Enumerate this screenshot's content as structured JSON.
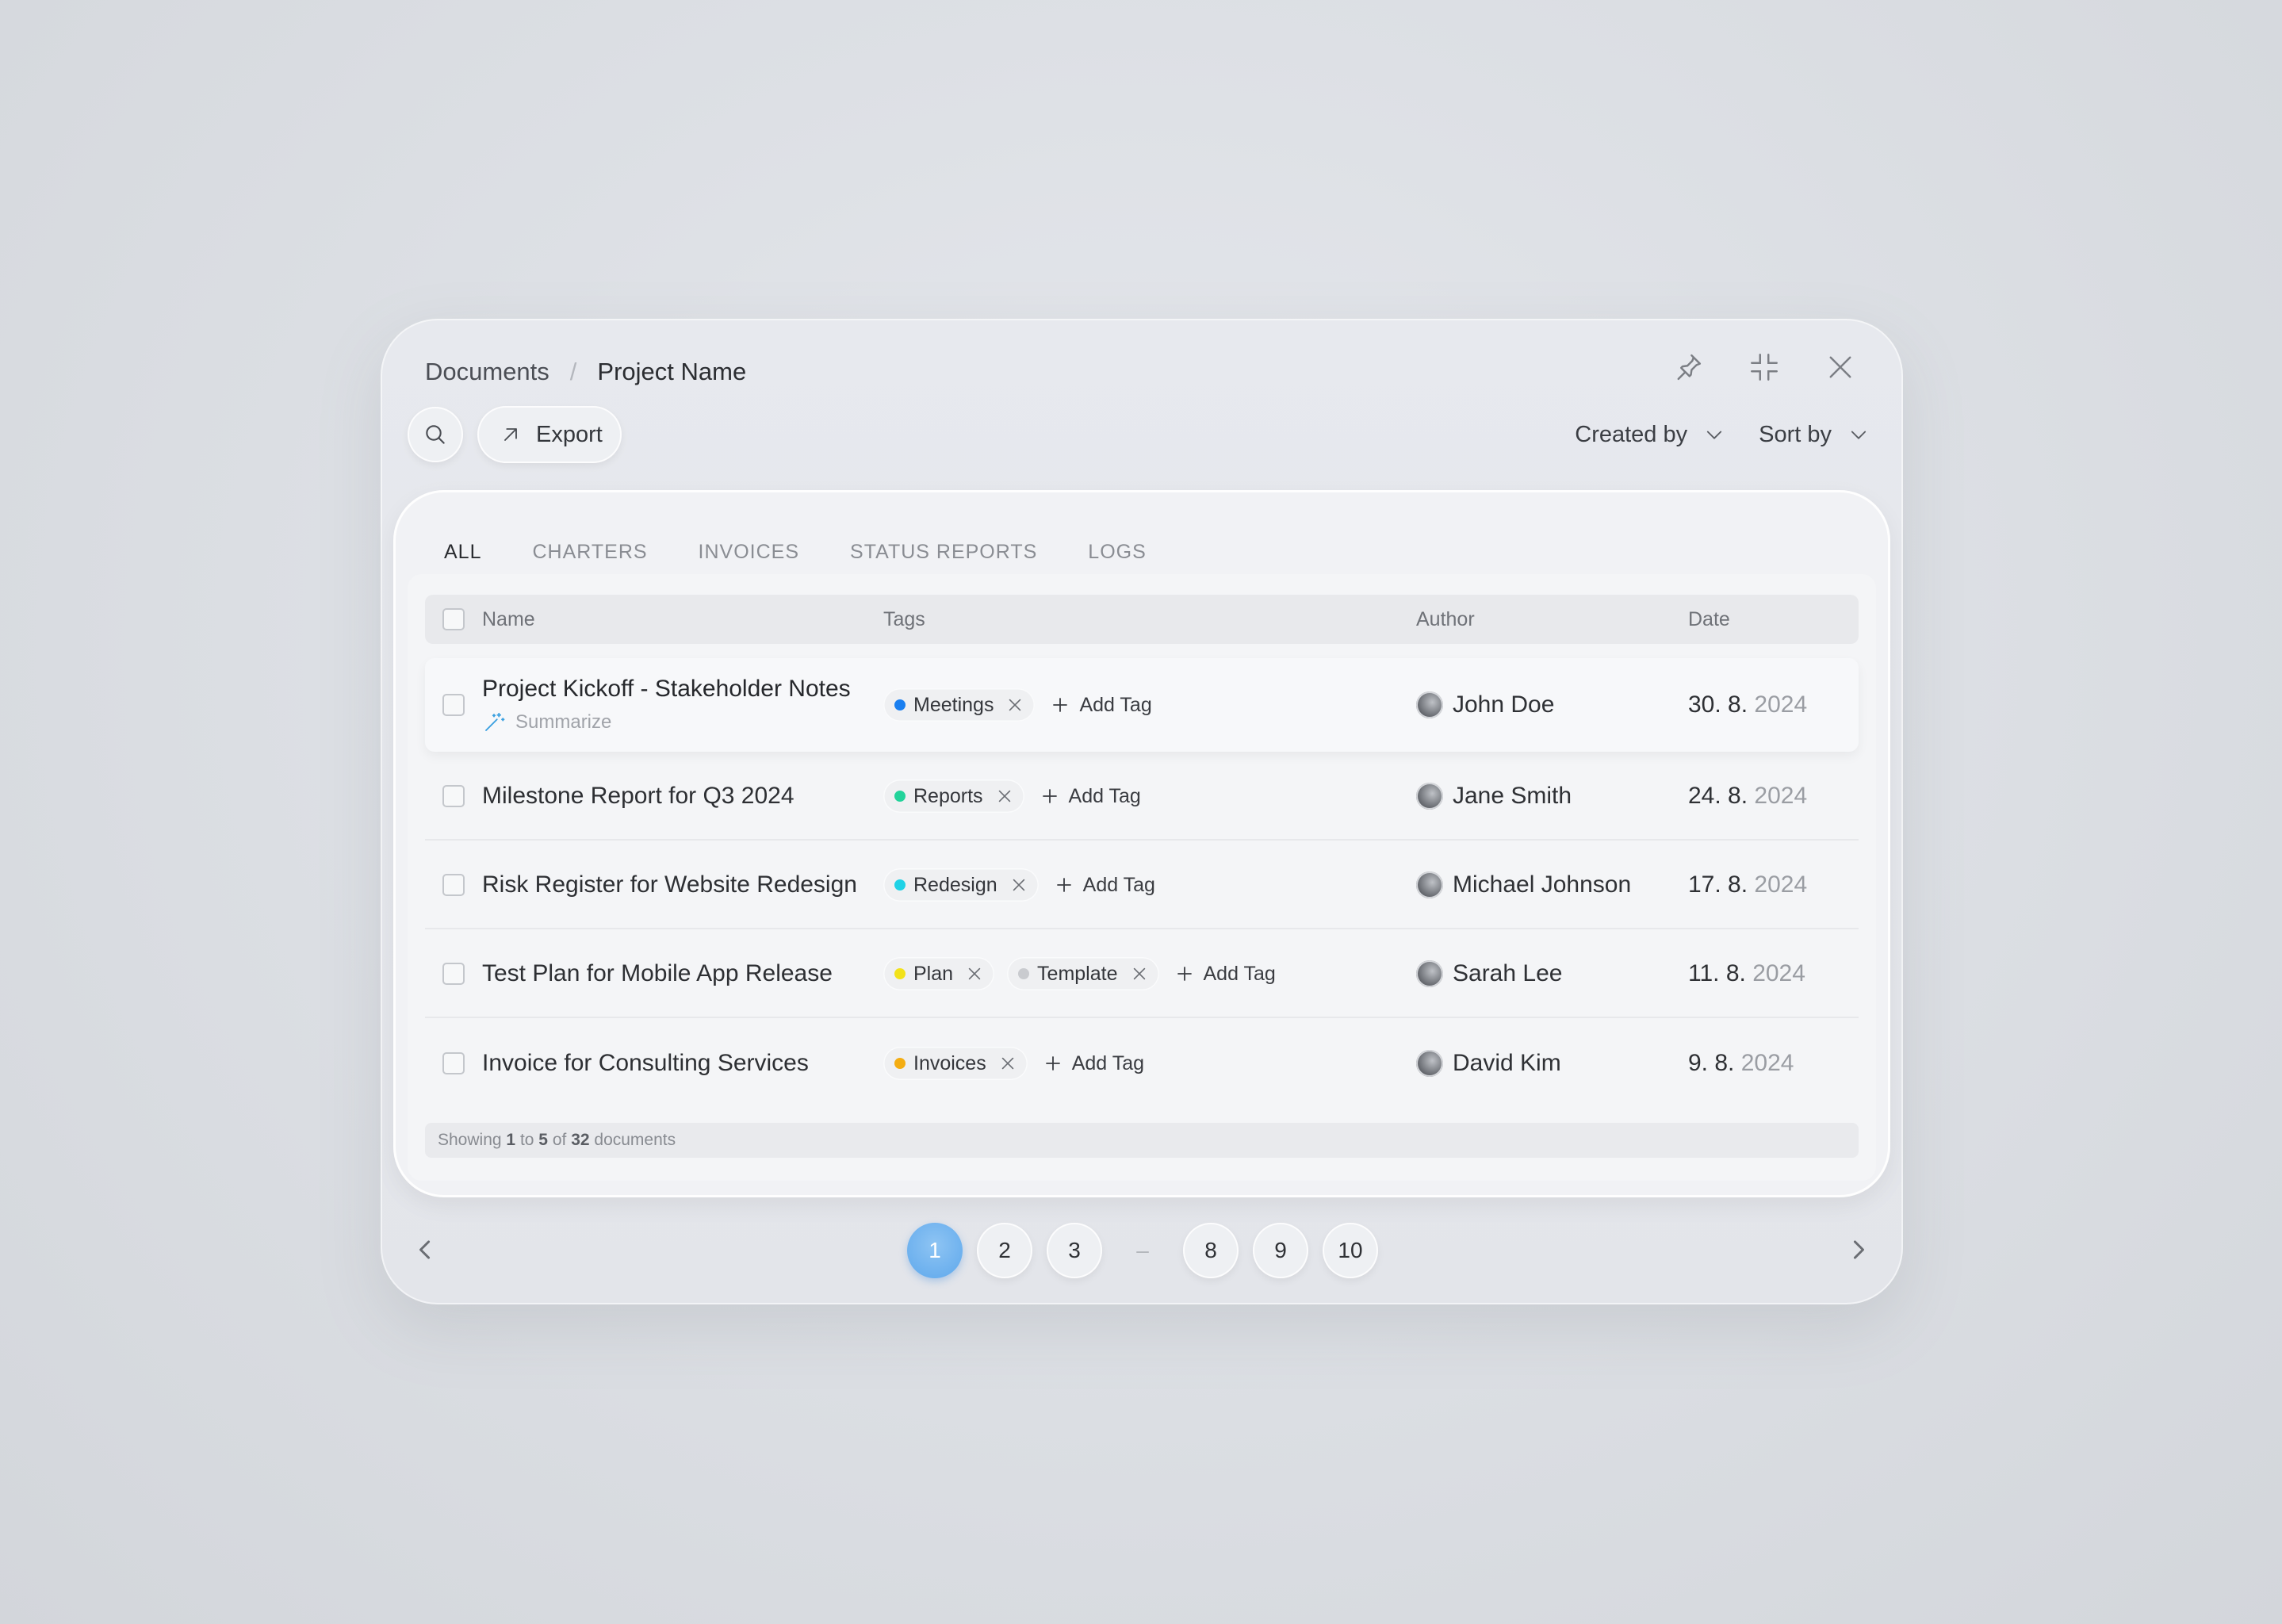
{
  "breadcrumb": {
    "root": "Documents",
    "separator": "/",
    "current": "Project Name"
  },
  "window_icons": [
    "pin-icon",
    "minimize-icon",
    "close-icon"
  ],
  "toolbar": {
    "search_icon": "search-icon",
    "export_label": "Export",
    "created_by_label": "Created by",
    "sort_by_label": "Sort by"
  },
  "tabs": [
    {
      "label": "ALL",
      "active": true
    },
    {
      "label": "CHARTERS",
      "active": false
    },
    {
      "label": "INVOICES",
      "active": false
    },
    {
      "label": "STATUS REPORTS",
      "active": false
    },
    {
      "label": "LOGS",
      "active": false
    }
  ],
  "table": {
    "headers": {
      "name": "Name",
      "tags": "Tags",
      "author": "Author",
      "date": "Date"
    },
    "add_tag_label": "Add Tag",
    "summarize_label": "Summarize",
    "rows": [
      {
        "name": "Project Kickoff - Stakeholder Notes",
        "tags": [
          {
            "label": "Meetings",
            "color": "#1a7ff0"
          }
        ],
        "author": "John Doe",
        "date_day": "30. 8.",
        "date_year": "2024"
      },
      {
        "name": "Milestone Report for Q3 2024",
        "tags": [
          {
            "label": "Reports",
            "color": "#22d39a"
          }
        ],
        "author": "Jane Smith",
        "date_day": "24. 8.",
        "date_year": "2024"
      },
      {
        "name": "Risk Register for Website Redesign",
        "tags": [
          {
            "label": "Redesign",
            "color": "#1fd2e6"
          }
        ],
        "author": "Michael Johnson",
        "date_day": "17. 8.",
        "date_year": "2024"
      },
      {
        "name": "Test Plan for Mobile App Release",
        "tags": [
          {
            "label": "Plan",
            "color": "#f2e21a"
          },
          {
            "label": "Template",
            "color": "#c9cbcf"
          }
        ],
        "author": "Sarah Lee",
        "date_day": "11. 8.",
        "date_year": "2024"
      },
      {
        "name": "Invoice for Consulting Services",
        "tags": [
          {
            "label": "Invoices",
            "color": "#f4ad12"
          }
        ],
        "author": "David Kim",
        "date_day": "9. 8.",
        "date_year": "2024"
      }
    ]
  },
  "summary": {
    "prefix": "Showing",
    "from": "1",
    "to_word": "to",
    "to": "5",
    "of_word": "of",
    "total": "32",
    "suffix": "documents"
  },
  "pagination": {
    "pages": [
      "1",
      "2",
      "3"
    ],
    "ellipsis": "–",
    "pages_end": [
      "8",
      "9",
      "10"
    ],
    "current": "1",
    "accent": "#5ea8ec"
  }
}
